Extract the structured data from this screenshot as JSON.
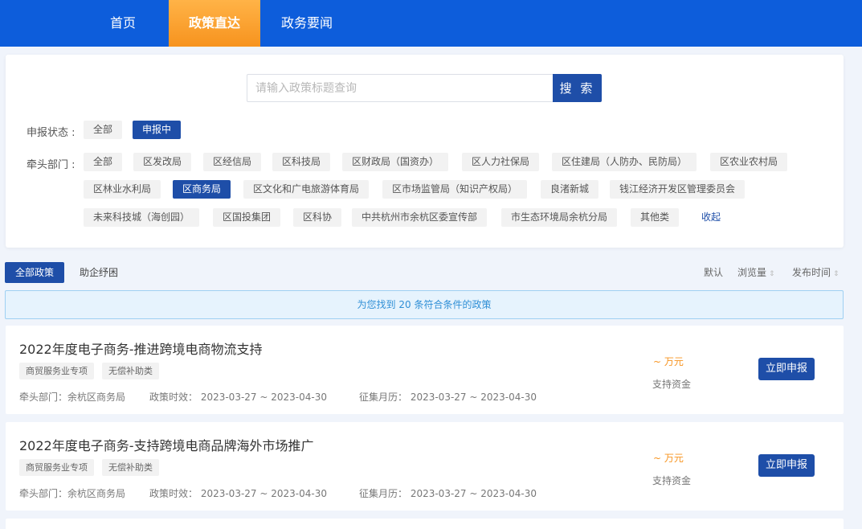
{
  "nav": {
    "items": [
      {
        "label": "首页",
        "active": false
      },
      {
        "label": "政策直达",
        "active": true
      },
      {
        "label": "政务要闻",
        "active": false
      }
    ]
  },
  "search": {
    "placeholder": "请输入政策标题查询",
    "button_label": "搜 索"
  },
  "filters": {
    "status": {
      "label": "申报状态 :",
      "options": [
        {
          "label": "全部",
          "active": false
        },
        {
          "label": "申报中",
          "active": true
        }
      ]
    },
    "department": {
      "label": "牵头部门 :",
      "options": [
        {
          "label": "全部",
          "active": false
        },
        {
          "label": "区发改局",
          "active": false
        },
        {
          "label": "区经信局",
          "active": false
        },
        {
          "label": "区科技局",
          "active": false
        },
        {
          "label": "区财政局（国资办）",
          "active": false
        },
        {
          "label": "区人力社保局",
          "active": false
        },
        {
          "label": "区住建局（人防办、民防局）",
          "active": false
        },
        {
          "label": "区农业农村局",
          "active": false
        },
        {
          "label": "区林业水利局",
          "active": false
        },
        {
          "label": "区商务局",
          "active": true
        },
        {
          "label": "区文化和广电旅游体育局",
          "active": false
        },
        {
          "label": "区市场监管局（知识产权局）",
          "active": false
        },
        {
          "label": "良渚新城",
          "active": false
        },
        {
          "label": "钱江经济开发区管理委员会",
          "active": false
        },
        {
          "label": "未来科技城（海创园）",
          "active": false
        },
        {
          "label": "区国投集团",
          "active": false
        },
        {
          "label": "区科协",
          "active": false
        },
        {
          "label": "中共杭州市余杭区委宣传部",
          "active": false
        },
        {
          "label": "市生态环境局余杭分局",
          "active": false
        },
        {
          "label": "其他类",
          "active": false
        }
      ],
      "collapse_label": "收起"
    }
  },
  "tabs": [
    {
      "label": "全部政策",
      "active": true
    },
    {
      "label": "助企纾困",
      "active": false
    }
  ],
  "sort": {
    "default_label": "默认",
    "views_label": "浏览量",
    "date_label": "发布时间"
  },
  "result_text": "为您找到 20 条符合条件的政策",
  "policies": [
    {
      "title": "2022年度电子商务-推进跨境电商物流支持",
      "tags": [
        "商贸服务业专项",
        "无偿补助类"
      ],
      "department": "牵头部门：余杭区商务局",
      "effective": "政策时效： 2023-03-27  ~  2023-04-30",
      "collection": "征集月历： 2023-03-27  ~  2023-04-30",
      "amount": "~  万元",
      "fund_label": "支持资金",
      "apply_label": "立即申报"
    },
    {
      "title": "2022年度电子商务-支持跨境电商品牌海外市场推广",
      "tags": [
        "商贸服务业专项",
        "无偿补助类"
      ],
      "department": "牵头部门：余杭区商务局",
      "effective": "政策时效： 2023-03-27  ~  2023-04-30",
      "collection": "征集月历： 2023-03-27  ~  2023-04-30",
      "amount": "~  万元",
      "fund_label": "支持资金",
      "apply_label": "立即申报"
    }
  ],
  "colors": {
    "nav_bg": "#0d5ddb",
    "nav_active": "#f7931e",
    "primary": "#1e4ea8",
    "accent_orange": "#f7931e",
    "info_blue": "#2f8fd6"
  }
}
